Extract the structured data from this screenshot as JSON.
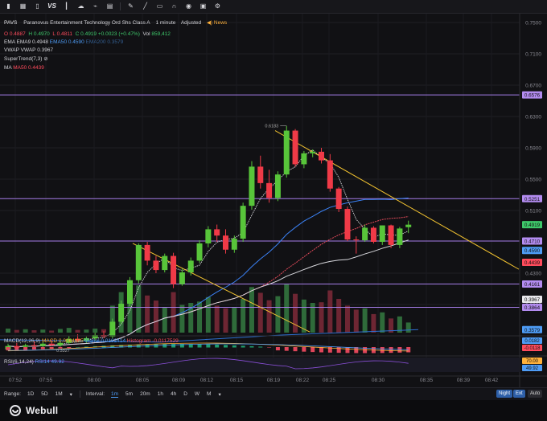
{
  "toolbar": {
    "icons": [
      "bar-chart-icon",
      "layout-grid-icon",
      "split-view-icon",
      "compare-vs-icon",
      "candle-style-icon",
      "cloud-icon",
      "indicator-icon",
      "calendar-icon",
      "draw-pen-icon",
      "drawing-line-icon",
      "ruler-icon",
      "magnet-icon",
      "eye-icon",
      "camera-icon",
      "settings-icon"
    ],
    "vs_label": "VS"
  },
  "title": {
    "symbol": "PAVS",
    "name": "Paranovus Entertainment Technology Ord Shs Class A",
    "interval": "1 minute",
    "adjust": "Adjusted",
    "news": "News"
  },
  "ohlc": {
    "o_label": "O",
    "o": "0.4887",
    "h_label": "H",
    "h": "0.4970",
    "l_label": "L",
    "l": "0.4811",
    "c_label": "C",
    "c": "0.4919",
    "chg": "+0.0023 (+0.47%)",
    "vol_label": "Vol",
    "vol": "859,412"
  },
  "indicators": {
    "ema_label": "EMA",
    "ema9": "EMA9 0.4948",
    "ema50": "EMA50 0.4590",
    "ema200": "EMA200 0.3579",
    "vwap_label": "VWAP",
    "vwap": "VWAP 0.3967",
    "supertrend": "SuperTrend(7,3)",
    "ma_label": "MA",
    "ma50": "MA50 0.4439"
  },
  "price_axis": {
    "ticks": [
      "0.7500",
      "0.7100",
      "0.6700",
      "0.6300",
      "0.5900",
      "0.5500",
      "0.5100",
      "0.4300",
      "0.3900"
    ],
    "tags": [
      {
        "v": "0.6576",
        "c": "#b38cf0",
        "fg": "#111"
      },
      {
        "v": "0.5251",
        "c": "#b38cf0",
        "fg": "#111"
      },
      {
        "v": "0.4919",
        "c": "#3ec76a",
        "fg": "#111"
      },
      {
        "v": "0.4710",
        "c": "#b38cf0",
        "fg": "#111"
      },
      {
        "v": "0.4590",
        "c": "#4e9cf5",
        "fg": "#111"
      },
      {
        "v": "0.4439",
        "c": "#ff4b5c",
        "fg": "#111"
      },
      {
        "v": "0.4161",
        "c": "#b38cf0",
        "fg": "#111"
      },
      {
        "v": "0.3967",
        "c": "#e8e8ec",
        "fg": "#111"
      },
      {
        "v": "0.3864",
        "c": "#b38cf0",
        "fg": "#111"
      },
      {
        "v": "0.3579",
        "c": "#4e9cf5",
        "fg": "#111"
      }
    ],
    "high_label": "0.6183",
    "low_label": "0.3327"
  },
  "time_axis": [
    "07:52",
    "07:55",
    "08:00",
    "08:05",
    "08:09",
    "08:12",
    "08:15",
    "08:19",
    "08:22",
    "08:25",
    "08:30",
    "08:35",
    "08:39",
    "08:42"
  ],
  "macd": {
    "label": "MACD(12,26,9)",
    "macd": "MACD 0.0064885",
    "signal": "Signal 0.0182414",
    "hist": "Histogram -0.0117529",
    "tags": [
      {
        "v": "0.0182",
        "c": "#4e9cf5",
        "fg": "#111"
      },
      {
        "v": "-0.0118",
        "c": "#ff4b5c",
        "fg": "#111"
      }
    ]
  },
  "rsi": {
    "label": "RSI(6,14,24)",
    "value": "RSI14 49.92",
    "tags": [
      {
        "v": "70.00",
        "c": "#ffb13b",
        "fg": "#111"
      },
      {
        "v": "49.92",
        "c": "#4e9cf5",
        "fg": "#111"
      }
    ]
  },
  "range": {
    "label": "Range:",
    "items": [
      "1D",
      "5D",
      "1M"
    ],
    "interval_label": "Interval:",
    "intervals": [
      "1m",
      "5m",
      "20m",
      "1h",
      "4h",
      "D",
      "W",
      "M"
    ],
    "selected_interval": "1m",
    "night": "Night",
    "ext": "Ext",
    "auto": "Auto"
  },
  "brand": "Webull",
  "chart_data": {
    "type": "candlestick",
    "ylim": [
      0.33,
      0.76
    ],
    "candles": [
      [
        0.3327,
        0.34,
        0.331,
        0.337
      ],
      [
        0.337,
        0.341,
        0.333,
        0.335
      ],
      [
        0.336,
        0.34,
        0.334,
        0.338
      ],
      [
        0.338,
        0.343,
        0.335,
        0.337
      ],
      [
        0.337,
        0.342,
        0.334,
        0.34
      ],
      [
        0.34,
        0.345,
        0.337,
        0.338
      ],
      [
        0.338,
        0.343,
        0.336,
        0.341
      ],
      [
        0.341,
        0.35,
        0.339,
        0.346
      ],
      [
        0.346,
        0.352,
        0.342,
        0.344
      ],
      [
        0.344,
        0.349,
        0.341,
        0.347
      ],
      [
        0.347,
        0.354,
        0.344,
        0.351
      ],
      [
        0.351,
        0.356,
        0.347,
        0.349
      ],
      [
        0.349,
        0.372,
        0.347,
        0.368
      ],
      [
        0.368,
        0.395,
        0.365,
        0.391
      ],
      [
        0.391,
        0.425,
        0.388,
        0.421
      ],
      [
        0.421,
        0.468,
        0.417,
        0.466
      ],
      [
        0.466,
        0.47,
        0.44,
        0.446
      ],
      [
        0.446,
        0.452,
        0.43,
        0.434
      ],
      [
        0.434,
        0.455,
        0.431,
        0.452
      ],
      [
        0.452,
        0.456,
        0.411,
        0.416
      ],
      [
        0.416,
        0.436,
        0.414,
        0.431
      ],
      [
        0.431,
        0.45,
        0.427,
        0.446
      ],
      [
        0.446,
        0.472,
        0.443,
        0.468
      ],
      [
        0.468,
        0.49,
        0.463,
        0.486
      ],
      [
        0.486,
        0.492,
        0.47,
        0.478
      ],
      [
        0.478,
        0.486,
        0.455,
        0.46
      ],
      [
        0.46,
        0.478,
        0.456,
        0.474
      ],
      [
        0.474,
        0.52,
        0.47,
        0.516
      ],
      [
        0.516,
        0.573,
        0.511,
        0.566
      ],
      [
        0.566,
        0.58,
        0.538,
        0.545
      ],
      [
        0.545,
        0.562,
        0.52,
        0.526
      ],
      [
        0.526,
        0.56,
        0.522,
        0.556
      ],
      [
        0.556,
        0.618,
        0.552,
        0.612
      ],
      [
        0.612,
        0.614,
        0.566,
        0.569
      ],
      [
        0.569,
        0.586,
        0.564,
        0.583
      ],
      [
        0.583,
        0.588,
        0.578,
        0.585
      ],
      [
        0.585,
        0.59,
        0.57,
        0.574
      ],
      [
        0.574,
        0.582,
        0.534,
        0.538
      ],
      [
        0.538,
        0.54,
        0.508,
        0.512
      ],
      [
        0.512,
        0.515,
        0.471,
        0.473
      ],
      [
        0.473,
        0.477,
        0.455,
        0.472
      ],
      [
        0.472,
        0.492,
        0.47,
        0.488
      ],
      [
        0.488,
        0.49,
        0.468,
        0.47
      ],
      [
        0.47,
        0.491,
        0.466,
        0.491
      ],
      [
        0.491,
        0.492,
        0.462,
        0.466
      ],
      [
        0.466,
        0.489,
        0.462,
        0.487
      ],
      [
        0.4887,
        0.497,
        0.4811,
        0.4919
      ]
    ],
    "volumes": [
      12,
      8,
      10,
      7,
      9,
      6,
      11,
      14,
      8,
      9,
      12,
      10,
      80,
      120,
      135,
      140,
      110,
      95,
      75,
      120,
      82,
      88,
      92,
      105,
      80,
      72,
      75,
      100,
      135,
      118,
      96,
      108,
      145,
      115,
      98,
      88,
      90,
      125,
      100,
      80,
      68,
      72,
      55,
      60,
      42,
      48,
      30
    ],
    "horizontal_levels": [
      0.6576,
      0.5251,
      0.471,
      0.4161,
      0.3864
    ],
    "trendlines": [
      [
        [
          0.468,
          0.353
        ]
      ],
      [
        [
          0.612,
          0.435
        ]
      ]
    ]
  }
}
